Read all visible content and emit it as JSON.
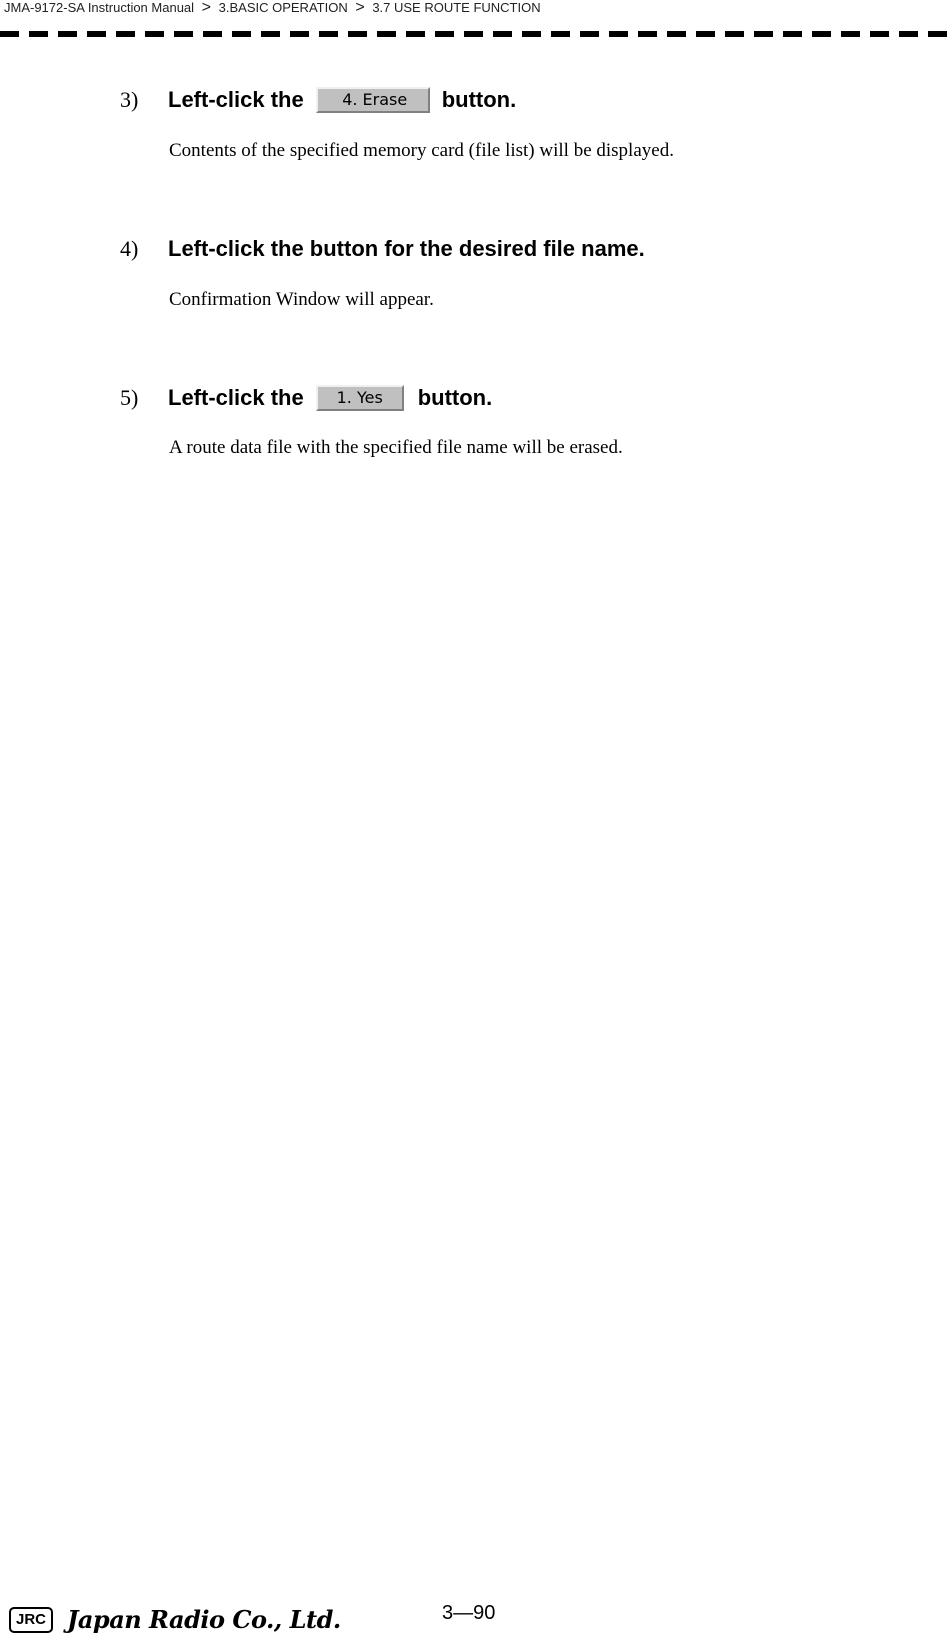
{
  "header": {
    "breadcrumb": [
      "JMA-9172-SA Instruction Manual",
      "3.BASIC OPERATION",
      "3.7  USE ROUTE FUNCTION"
    ],
    "separator": ">"
  },
  "steps": [
    {
      "number": "3)",
      "prefix": "Left-click the",
      "button_label": "4. Erase",
      "suffix": "button.",
      "description": "Contents of the specified memory card (file list) will be displayed."
    },
    {
      "number": "4)",
      "text": "Left-click the button for the desired file name.",
      "description": "Confirmation Window will appear."
    },
    {
      "number": "5)",
      "prefix": "Left-click the",
      "button_label": "1. Yes",
      "suffix": "button.",
      "description": "A route data file with the specified file name will be erased."
    }
  ],
  "footer": {
    "logo_text": "JRC",
    "company": "Japan Radio Co., Ltd.",
    "page_number": "3—90"
  }
}
